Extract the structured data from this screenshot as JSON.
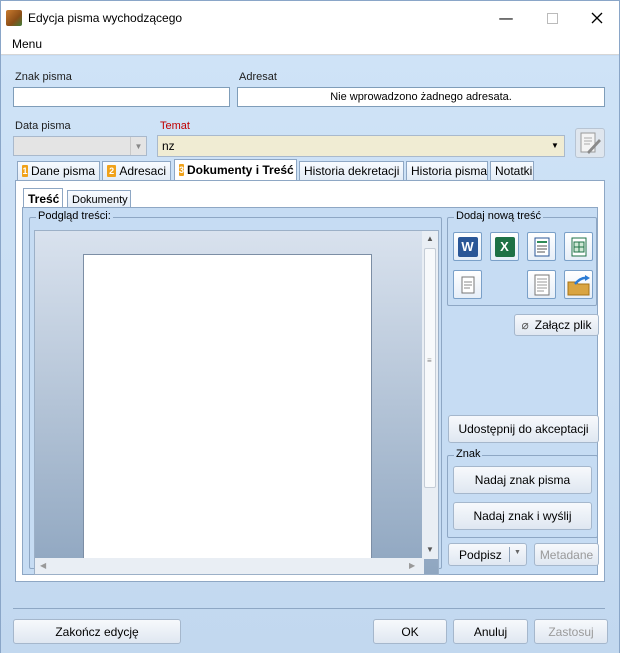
{
  "window": {
    "title": "Edycja pisma wychodzącego"
  },
  "menu": {
    "label": "Menu"
  },
  "fields": {
    "znak_label": "Znak pisma",
    "znak_value": "",
    "adresat_label": "Adresat",
    "adresat_value": "Nie wprowadzono żadnego adresata.",
    "data_label": "Data pisma",
    "data_value": "",
    "temat_label": "Temat",
    "temat_value": "nz"
  },
  "tabs": [
    {
      "num": "1",
      "label": "Dane pisma"
    },
    {
      "num": "2",
      "label": "Adresaci"
    },
    {
      "num": "3",
      "label": "Dokumenty i Treść"
    },
    {
      "num": "",
      "label": "Historia dekretacji"
    },
    {
      "num": "",
      "label": "Historia pisma"
    },
    {
      "num": "",
      "label": "Notatki"
    }
  ],
  "subtabs": [
    {
      "label": "Treść"
    },
    {
      "label": "Dokumenty"
    }
  ],
  "preview": {
    "title": "Podgląd treści:"
  },
  "add_content": {
    "title": "Dodaj nową treść"
  },
  "buttons": {
    "attach": "Załącz plik",
    "share": "Udostępnij do akceptacji",
    "assign_sign": "Nadaj znak pisma",
    "assign_send": "Nadaj znak i wyślij",
    "sign": "Podpisz",
    "metadata": "Metadane",
    "finish": "Zakończ edycję",
    "ok": "OK",
    "cancel": "Anuluj",
    "apply": "Zastosuj"
  },
  "znak_group": {
    "title": "Znak"
  },
  "colors": {
    "accent_tab": "#f0a21a",
    "required_label": "#c00000",
    "temat_bg": "#f0ecd3"
  }
}
